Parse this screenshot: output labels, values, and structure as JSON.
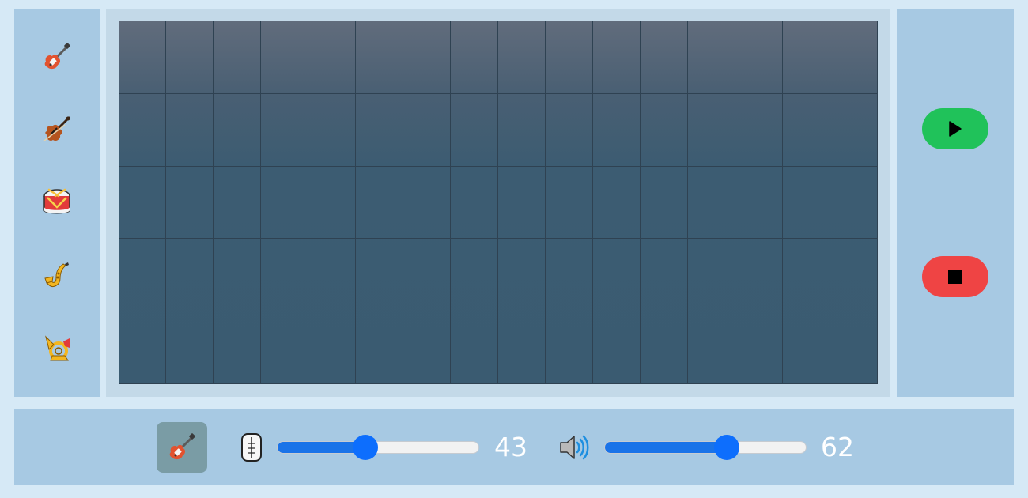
{
  "instruments": [
    {
      "name": "electric-guitar-icon",
      "selected": true
    },
    {
      "name": "violin-icon",
      "selected": false
    },
    {
      "name": "drum-icon",
      "selected": false
    },
    {
      "name": "saxophone-icon",
      "selected": false
    },
    {
      "name": "horn-icon",
      "selected": false
    }
  ],
  "grid": {
    "rows": 5,
    "cols": 16
  },
  "transport": {
    "play_icon": "play-icon",
    "stop_icon": "stop-icon",
    "play_color": "#20c25a",
    "stop_color": "#ef4444"
  },
  "controls": {
    "current_instrument": "electric-guitar-icon",
    "tempo": {
      "icon": "metronome-icon",
      "value": 43,
      "min": 0,
      "max": 100,
      "display": "43"
    },
    "volume": {
      "icon": "speaker-icon",
      "value": 62,
      "min": 0,
      "max": 100,
      "display": "62"
    }
  },
  "colors": {
    "accent": "#0d6efd",
    "panel": "#a7c9e3",
    "background": "#d6e9f6"
  }
}
